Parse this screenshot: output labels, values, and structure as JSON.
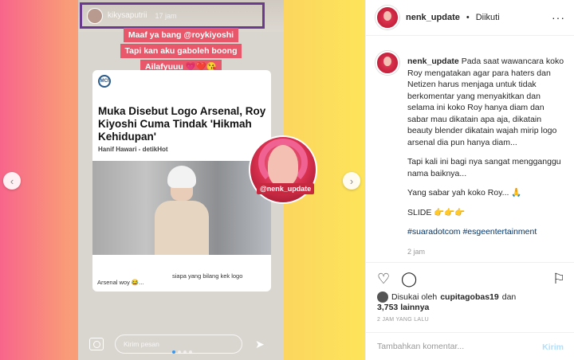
{
  "story": {
    "user": "kikysaputrii",
    "time": "17 jam",
    "caption_lines": [
      "Maaf ya bang @roykiyoshi",
      "Tapi kan aku gaboleh boong",
      "Ailafyuuu 💗❤️😘"
    ],
    "card": {
      "logo": "MCI",
      "title": "Muka Disebut Logo Arsenal, Roy Kiyoshi Cuma Tindak 'Hikmah Kehidupan'",
      "author": "Hanif Hawari - detikHot",
      "caption": "siapa yang bilang kek logo",
      "footer": "Arsenal woy 😂..."
    },
    "overlay_tag": "@nenk_update",
    "send_placeholder": "Kirim pesan",
    "send_icon": "send-icon",
    "camera_icon": "camera-icon"
  },
  "nav": {
    "prev_icon": "chevron-left-icon",
    "next_icon": "chevron-right-icon",
    "prev_glyph": "‹",
    "next_glyph": "›"
  },
  "header": {
    "username": "nenk_update",
    "separator": "•",
    "follow_status": "Diikuti",
    "more_glyph": "···"
  },
  "post": {
    "username": "nenk_update",
    "paragraph1": "Pada saat wawancara koko Roy mengatakan agar para haters dan Netizen harus menjaga untuk tidak berkomentar yang menyakitkan dan selama ini koko Roy hanya diam dan sabar mau dikatain apa aja, dikatain beauty blender dikatain wajah mirip logo arsenal dia pun hanya diam...",
    "paragraph2": "Tapi kali ini bagi nya sangat mengganggu nama baiknya...",
    "paragraph3": "Yang sabar yah koko Roy... 🙏",
    "paragraph4": "SLIDE 👉👉👉",
    "hashtags": "#suaradotcom #esgeentertainment",
    "more_time": "2 jam"
  },
  "actions": {
    "like_glyph": "♡",
    "comment_glyph": "◯",
    "bookmark_glyph": "⚐"
  },
  "likes": {
    "prefix": "Disukai oleh",
    "user": "cupitagobas19",
    "and": "dan",
    "count": "3,753 lainnya"
  },
  "time_ago": "2 JAM YANG LALU",
  "comment": {
    "placeholder": "Tambahkan komentar...",
    "post_label": "Kirim"
  }
}
